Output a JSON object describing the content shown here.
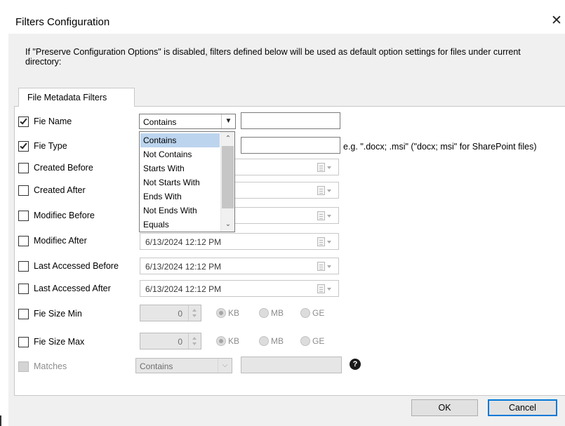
{
  "window": {
    "title": "Filters Configuration",
    "close_glyph": "✕"
  },
  "notice": "If \"Preserve Configuration Options\" is disabled, filters defined below will be used as default option settings for files under current directory:",
  "tabs": [
    {
      "label": "File Metadata Filters",
      "active": true
    }
  ],
  "filters": {
    "file_name": {
      "label": "Fie Name",
      "checked": true,
      "operator": "Contains",
      "value": ""
    },
    "file_type": {
      "label": "Fie Type",
      "checked": true,
      "value": "",
      "hint": "e.g. \".docx; .msi\" (\"docx; msi\" for SharePoint files)"
    },
    "created_before": {
      "label": "Created Before",
      "checked": false,
      "value": ""
    },
    "created_after": {
      "label": "Created After",
      "checked": false,
      "value": ""
    },
    "modified_before": {
      "label": "Modifiec Before",
      "checked": false,
      "value": ""
    },
    "modified_after": {
      "label": "Modifiec After",
      "checked": false,
      "value": "6/13/2024 12:12 PM"
    },
    "last_accessed_before": {
      "label": "Last Accessed Before",
      "checked": false,
      "value": "6/13/2024 12:12 PM"
    },
    "last_accessed_after": {
      "label": "Last Accessed After",
      "checked": false,
      "value": "6/13/2024 12:12 PM"
    },
    "file_size_min": {
      "label": "Fie Size Min",
      "checked": false,
      "value": "0",
      "units": [
        "KB",
        "MB",
        "GE"
      ],
      "selected_unit": "KB"
    },
    "file_size_max": {
      "label": "Fie Size Max",
      "checked": false,
      "value": "0",
      "units": [
        "KB",
        "MB",
        "GE"
      ],
      "selected_unit": "KB"
    },
    "matches": {
      "label": "Matches",
      "checked": false,
      "enabled": false,
      "operator": "Contains",
      "value": ""
    }
  },
  "operator_dropdown": {
    "open": true,
    "options": [
      "Contains",
      "Not Contains",
      "Starts With",
      "Not Starts With",
      "Ends With",
      "Not Ends With",
      "Equals"
    ],
    "selected": "Contains"
  },
  "buttons": {
    "ok": "OK",
    "cancel": "Cancel"
  },
  "icons": {
    "help": "?",
    "dropdown_arrow": "▾",
    "calendar": "calendar-icon"
  },
  "colors": {
    "accent": "#0078d7",
    "selection": "#bcd4ee",
    "window_bg": "#f0f0f0"
  }
}
